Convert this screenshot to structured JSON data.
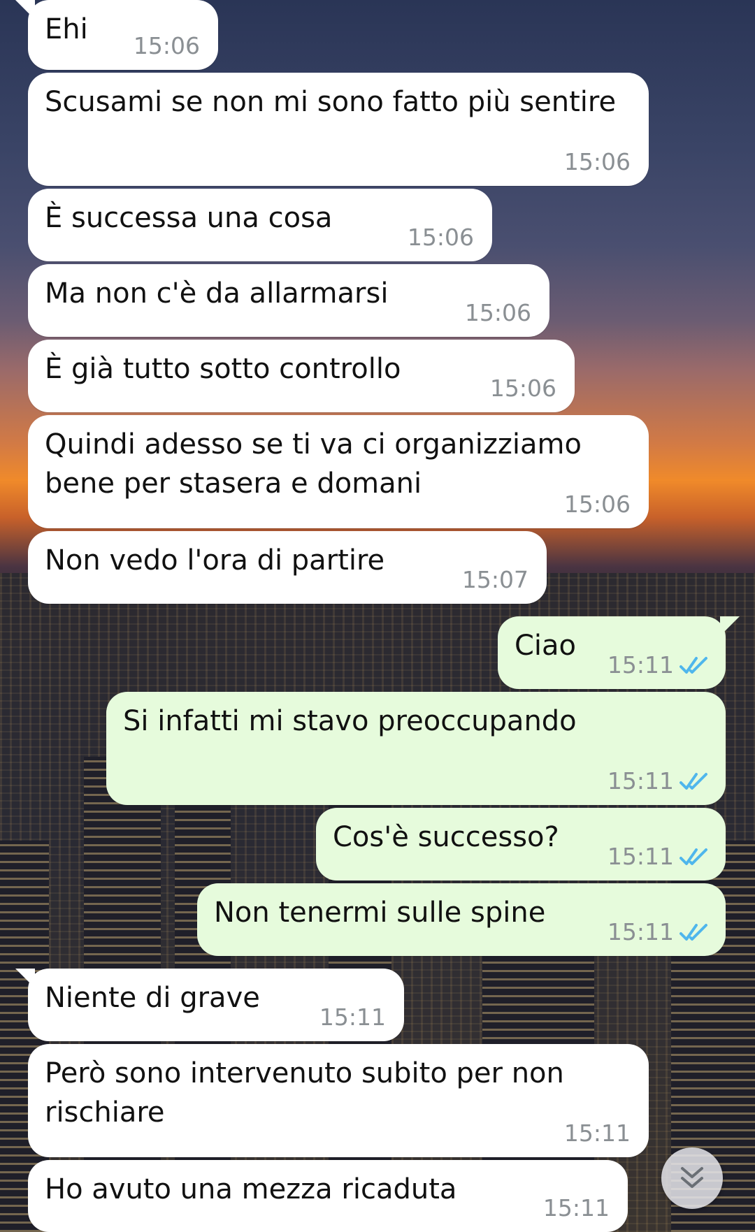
{
  "messages": [
    {
      "dir": "in",
      "text": "Ehi",
      "time": "15:06"
    },
    {
      "dir": "in",
      "text": "Scusami se non mi sono fatto più sentire",
      "time": "15:06"
    },
    {
      "dir": "in",
      "text": "È successa una cosa",
      "time": "15:06"
    },
    {
      "dir": "in",
      "text": "Ma non c'è da allarmarsi",
      "time": "15:06"
    },
    {
      "dir": "in",
      "text": "È già tutto sotto controllo",
      "time": "15:06"
    },
    {
      "dir": "in",
      "text": "Quindi adesso se ti va ci organizziamo bene per stasera e domani",
      "time": "15:06"
    },
    {
      "dir": "in",
      "text": "Non vedo l'ora di partire",
      "time": "15:07"
    },
    {
      "dir": "out",
      "text": "Ciao",
      "time": "15:11",
      "status": "read"
    },
    {
      "dir": "out",
      "text": "Si infatti mi stavo preoccupando",
      "time": "15:11",
      "status": "read"
    },
    {
      "dir": "out",
      "text": "Cos'è successo?",
      "time": "15:11",
      "status": "read"
    },
    {
      "dir": "out",
      "text": "Non tenermi sulle spine",
      "time": "15:11",
      "status": "read"
    },
    {
      "dir": "in",
      "text": "Niente di grave",
      "time": "15:11"
    },
    {
      "dir": "in",
      "text": "Però sono intervenuto subito per non rischiare",
      "time": "15:11"
    },
    {
      "dir": "in",
      "text": "Ho avuto una mezza ricaduta",
      "time": "15:11"
    }
  ],
  "icons": {
    "read_ticks": "double-check-icon",
    "scroll_down": "chevron-double-down-icon"
  },
  "colors": {
    "incoming_bubble": "#ffffff",
    "outgoing_bubble": "#e6fbdc",
    "timestamp": "#8a8f93",
    "read_ticks": "#4fb6ec"
  }
}
